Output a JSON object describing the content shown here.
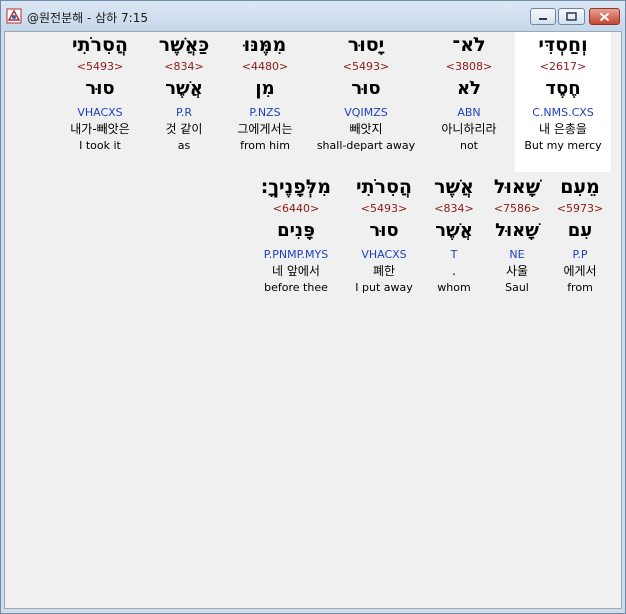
{
  "window": {
    "title": "@원전분해 - 삼하 7:15"
  },
  "rows": [
    [
      {
        "heb": "הֲסִרֹתִי",
        "strong": "<5493>",
        "lemma": "סוּר",
        "morph": "VHACXS",
        "kor": "내가-빼앗은",
        "eng": "I took it"
      },
      {
        "heb": "כַּאֲשֶׁר",
        "strong": "<834>",
        "lemma": "אֲשֶׁר",
        "morph": "P.R",
        "kor": "것 같이",
        "eng": "as"
      },
      {
        "heb": "מִמֶּנּוּ",
        "strong": "<4480>",
        "lemma": "מִן",
        "morph": "P.NZS",
        "kor": "그에게서는",
        "eng": "from him"
      },
      {
        "heb": "יָסוּר",
        "strong": "<5493>",
        "lemma": "סוּר",
        "morph": "VQIMZS",
        "kor": "빼앗지",
        "eng": "shall-depart away"
      },
      {
        "heb": "לֹא־",
        "strong": "<3808>",
        "lemma": "לֹא",
        "morph": "ABN",
        "kor": "아니하리라",
        "eng": "not"
      },
      {
        "heb": "וְחַסְדִּי",
        "strong": "<2617>",
        "lemma": "חֶסֶד",
        "morph": "C.NMS.CXS",
        "kor": "내 은총을",
        "eng": "But my mercy",
        "selected": true
      }
    ],
    [
      {
        "heb": "מִלְּפָנֶיךָ׃",
        "strong": "<6440>",
        "lemma": "פָּנִים",
        "morph": "P.PNMP.MYS",
        "kor": "네 앞에서",
        "eng": "before thee"
      },
      {
        "heb": "הֲסִרֹתִי",
        "strong": "<5493>",
        "lemma": "סוּר",
        "morph": "VHACXS",
        "kor": "폐한",
        "eng": "I put away"
      },
      {
        "heb": "אֲשֶׁר",
        "strong": "<834>",
        "lemma": "אֲשֶׁר",
        "morph": "T",
        "kor": ".",
        "eng": "whom"
      },
      {
        "heb": "שָׁאוּל",
        "strong": "<7586>",
        "lemma": "שָׁאוּל",
        "morph": "NE",
        "kor": "사울",
        "eng": "Saul"
      },
      {
        "heb": "מֵעִם",
        "strong": "<5973>",
        "lemma": "עִם",
        "morph": "P.P",
        "kor": "에게서",
        "eng": "from"
      }
    ]
  ]
}
